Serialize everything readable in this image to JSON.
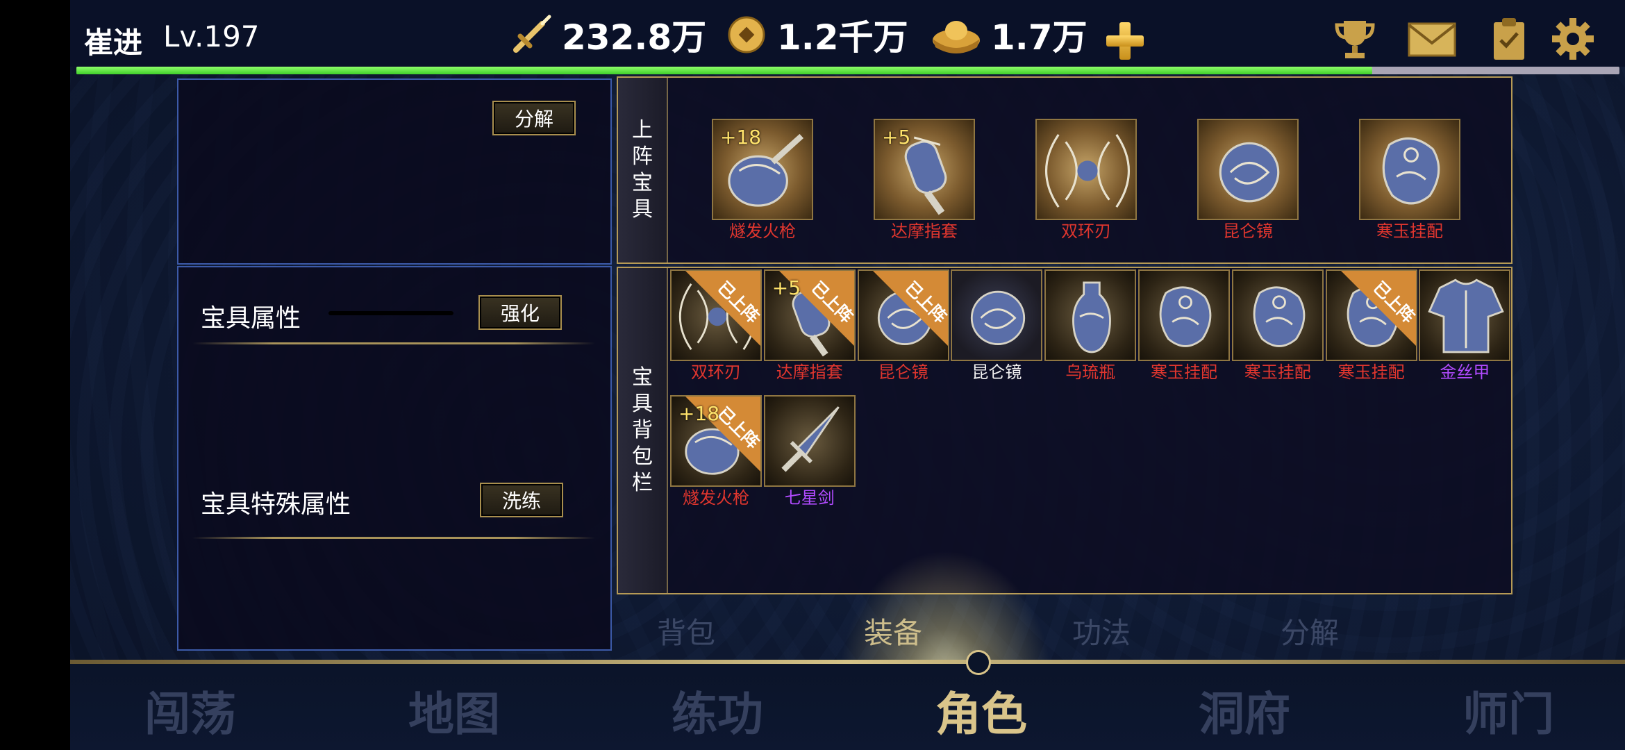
{
  "player": {
    "name": "崔进",
    "level": "Lv.197"
  },
  "resources": {
    "power": "232.8万",
    "gold": "1.2千万",
    "ingot": "1.7万"
  },
  "xp_fraction": 0.84,
  "left": {
    "decompose_label": "分解",
    "attr_title": "宝具属性",
    "enhance_label": "强化",
    "special_title": "宝具特殊属性",
    "refine_label": "洗练"
  },
  "equipped_section": {
    "label": "上阵宝具"
  },
  "bag_section": {
    "label": "宝具背包栏"
  },
  "equipped": [
    {
      "name": "燧发火枪",
      "enh": "+18",
      "rarity": "red",
      "icon": "flintlock-icon"
    },
    {
      "name": "达摩指套",
      "enh": "+5",
      "rarity": "red",
      "icon": "finger-guard-icon"
    },
    {
      "name": "双环刃",
      "enh": "",
      "rarity": "red",
      "icon": "twin-ring-blade-icon"
    },
    {
      "name": "昆仑镜",
      "enh": "",
      "rarity": "red",
      "icon": "kunlun-mirror-icon"
    },
    {
      "name": "寒玉挂配",
      "enh": "",
      "rarity": "red",
      "icon": "jade-pendant-icon"
    }
  ],
  "bag": [
    {
      "name": "双环刃",
      "enh": "",
      "on_label": "已上阵",
      "rarity": "red",
      "icon": "twin-ring-blade-icon"
    },
    {
      "name": "达摩指套",
      "enh": "+5",
      "on_label": "已上阵",
      "rarity": "red",
      "icon": "finger-guard-icon"
    },
    {
      "name": "昆仑镜",
      "enh": "",
      "on_label": "已上阵",
      "rarity": "red",
      "icon": "kunlun-mirror-icon"
    },
    {
      "name": "昆仑镜",
      "enh": "",
      "on_label": "",
      "rarity": "white",
      "icon": "kunlun-mirror-icon"
    },
    {
      "name": "乌琉瓶",
      "enh": "",
      "on_label": "",
      "rarity": "red",
      "icon": "glazed-vase-icon"
    },
    {
      "name": "寒玉挂配",
      "enh": "",
      "on_label": "",
      "rarity": "red",
      "icon": "jade-pendant-icon"
    },
    {
      "name": "寒玉挂配",
      "enh": "",
      "on_label": "",
      "rarity": "red",
      "icon": "jade-pendant-icon"
    },
    {
      "name": "寒玉挂配",
      "enh": "",
      "on_label": "已上阵",
      "rarity": "red",
      "icon": "jade-pendant-icon"
    },
    {
      "name": "金丝甲",
      "enh": "",
      "on_label": "",
      "rarity": "purple",
      "icon": "gold-armor-icon"
    },
    {
      "name": "燧发火枪",
      "enh": "+18",
      "on_label": "已上阵",
      "rarity": "red",
      "icon": "flintlock-icon"
    },
    {
      "name": "七星剑",
      "enh": "",
      "on_label": "",
      "rarity": "purple",
      "icon": "seven-star-sword-icon"
    }
  ],
  "sub_tabs": [
    {
      "label": "背包",
      "active": false
    },
    {
      "label": "装备",
      "active": true
    },
    {
      "label": "功法",
      "active": false
    },
    {
      "label": "分解",
      "active": false
    }
  ],
  "nav_tabs": [
    {
      "label": "闯荡",
      "active": false
    },
    {
      "label": "地图",
      "active": false
    },
    {
      "label": "练功",
      "active": false
    },
    {
      "label": "角色",
      "active": true
    },
    {
      "label": "洞府",
      "active": false
    },
    {
      "label": "师门",
      "active": false
    }
  ],
  "colors": {
    "accent_gold": "#d9c48a",
    "xp_green": "#5ee33a",
    "rarity_red": "#e0362e",
    "rarity_purple": "#b14bff"
  }
}
